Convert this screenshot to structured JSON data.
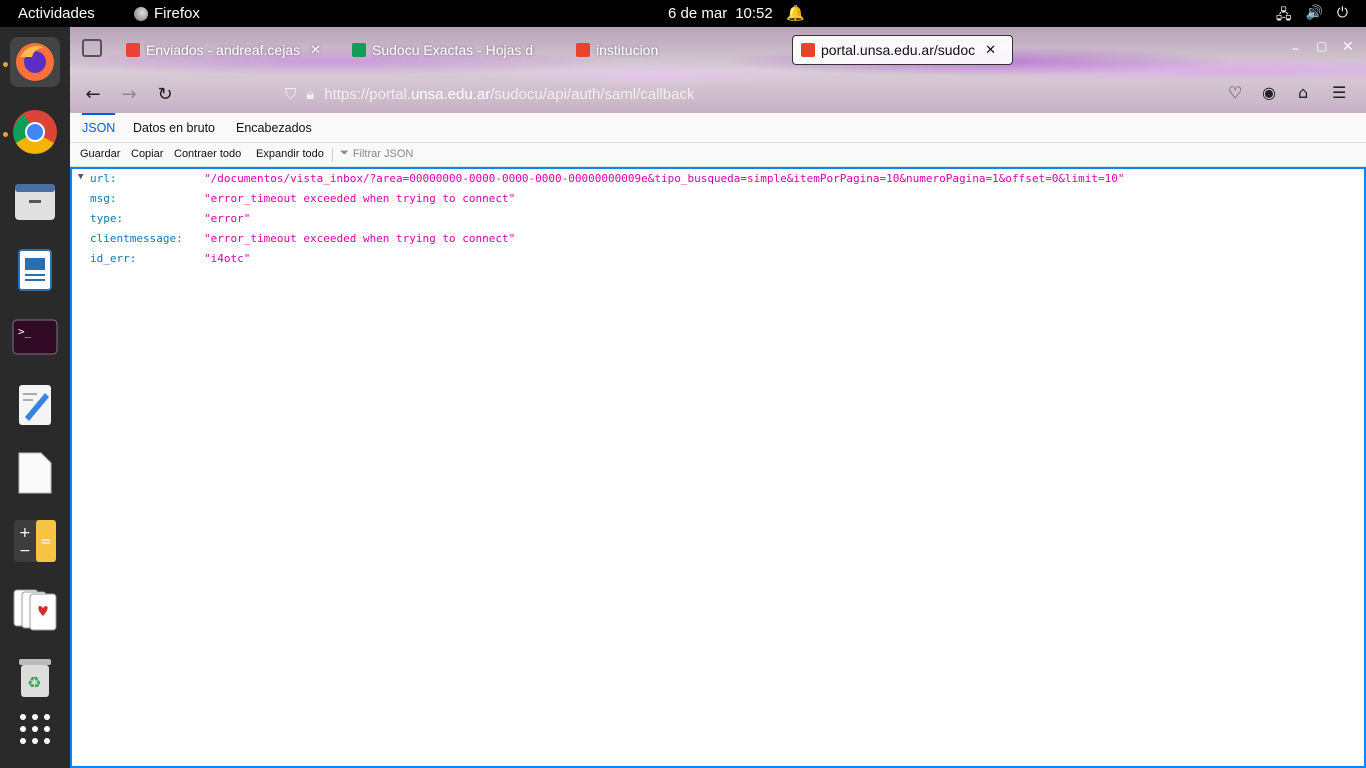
{
  "topbar": {
    "activities": "Actividades",
    "app_name": "Firefox",
    "date": "6 de mar",
    "time": "10:52"
  },
  "dock": {
    "items": [
      "firefox-icon",
      "chrome-icon",
      "files-icon",
      "writer-icon",
      "terminal-icon",
      "text-editor-icon",
      "document-icon",
      "calculator-icon",
      "solitaire-icon",
      "trash-icon",
      "app-grid-icon"
    ]
  },
  "browser": {
    "tabs": [
      {
        "label": "Enviados - andreaf.cejas",
        "favicon_color": "#ea4335"
      },
      {
        "label": "Sudocu Exactas - Hojas d",
        "favicon_color": "#0f9d58"
      },
      {
        "label": "institucion",
        "favicon_color": "#e8442c"
      },
      {
        "label": "portal.unsa.edu.ar/sudoc",
        "favicon_color": "#e8442c"
      }
    ],
    "url": {
      "prefix": "https://portal.",
      "host": "unsa.edu.ar",
      "path": "/sudocu/api/auth/saml/callback"
    }
  },
  "viewer": {
    "tabs": [
      "JSON",
      "Datos en bruto",
      "Encabezados"
    ],
    "toolbar": {
      "save": "Guardar",
      "copy": "Copiar",
      "collapse": "Contraer todo",
      "expand": "Expandir todo",
      "filter_placeholder": "Filtrar JSON"
    },
    "rows": [
      {
        "key": "url:",
        "value": "\"/documentos/vista_inbox/?area=00000000-0000-0000-0000-00000000009e&tipo_busqueda=simple&itemPorPagina=10&numeroPagina=1&offset=0&limit=10\""
      },
      {
        "key": "msg:",
        "value": "\"error_timeout exceeded when trying to connect\""
      },
      {
        "key": "type:",
        "value": "\"error\""
      },
      {
        "key": "clientmessage:",
        "value": "\"error_timeout exceeded when trying to connect\""
      },
      {
        "key": "id_err:",
        "value": "\"i4otc\""
      }
    ]
  }
}
